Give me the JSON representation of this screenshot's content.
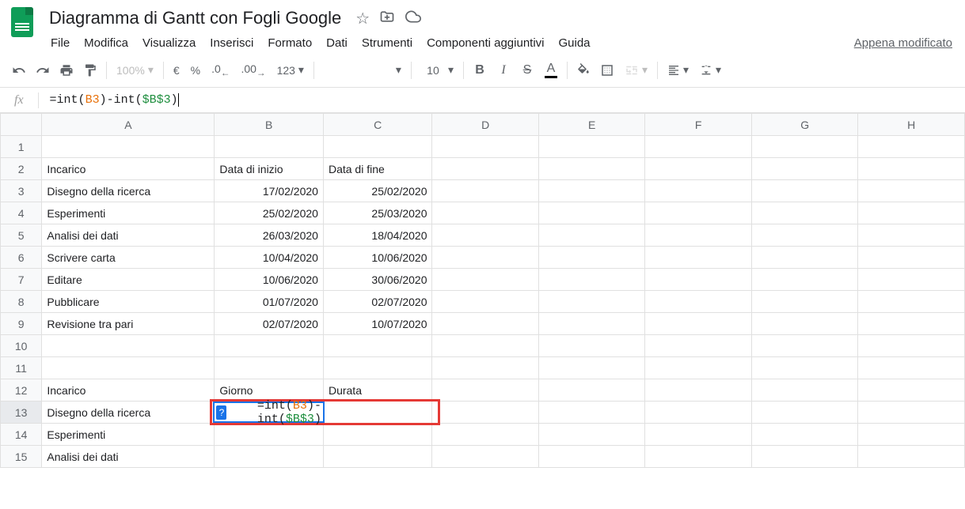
{
  "doc_title": "Diagramma di Gantt con Fogli Google",
  "menus": [
    "File",
    "Modifica",
    "Visualizza",
    "Inserisci",
    "Formato",
    "Dati",
    "Strumenti",
    "Componenti aggiuntivi",
    "Guida"
  ],
  "last_edit": "Appena modificato",
  "toolbar": {
    "zoom": "100%",
    "currency": "€",
    "percent": "%",
    "dec_dec": ".0",
    "dec_inc": ".00",
    "num_format": "123",
    "font_size": "10"
  },
  "formula_bar": {
    "prefix": "=int(",
    "ref1": "B3",
    "mid": ")-int(",
    "ref2": "$B$3",
    "suffix": ")"
  },
  "columns": [
    "A",
    "B",
    "C",
    "D",
    "E",
    "F",
    "G",
    "H"
  ],
  "rows": [
    {
      "n": 1,
      "a": "",
      "b": "",
      "c": ""
    },
    {
      "n": 2,
      "a": "Incarico",
      "b": "Data di inizio",
      "c": "Data di fine",
      "bold": true,
      "b_align": "left",
      "c_align": "left"
    },
    {
      "n": 3,
      "a": "Disegno della ricerca",
      "b": "17/02/2020",
      "c": "25/02/2020",
      "b_dashed": true
    },
    {
      "n": 4,
      "a": "Esperimenti",
      "b": "25/02/2020",
      "c": "25/03/2020"
    },
    {
      "n": 5,
      "a": "Analisi dei dati",
      "b": "26/03/2020",
      "c": "18/04/2020"
    },
    {
      "n": 6,
      "a": "Scrivere carta",
      "b": "10/04/2020",
      "c": "10/06/2020"
    },
    {
      "n": 7,
      "a": "Editare",
      "b": "10/06/2020",
      "c": "30/06/2020"
    },
    {
      "n": 8,
      "a": "Pubblicare",
      "b": "01/07/2020",
      "c": "02/07/2020"
    },
    {
      "n": 9,
      "a": "Revisione tra pari",
      "b": "02/07/2020",
      "c": "10/07/2020"
    },
    {
      "n": 10,
      "a": "",
      "b": "",
      "c": ""
    },
    {
      "n": 11,
      "a": "",
      "b": "",
      "c": ""
    },
    {
      "n": 12,
      "a": "Incarico",
      "b": "Giorno",
      "c": "Durata",
      "bold": true,
      "b_align": "left",
      "c_align": "left"
    },
    {
      "n": 13,
      "a": "Disegno della ricerca",
      "b_formula": true,
      "active": true
    },
    {
      "n": 14,
      "a": "Esperimenti",
      "b": "",
      "c": ""
    },
    {
      "n": 15,
      "a": "Analisi dei dati",
      "b": "",
      "c": ""
    }
  ],
  "cell_formula": {
    "hint": "?",
    "prefix": "=int(",
    "ref1": "B3",
    "mid": ")-int(",
    "ref2": "$B$3",
    "suffix": ")"
  }
}
